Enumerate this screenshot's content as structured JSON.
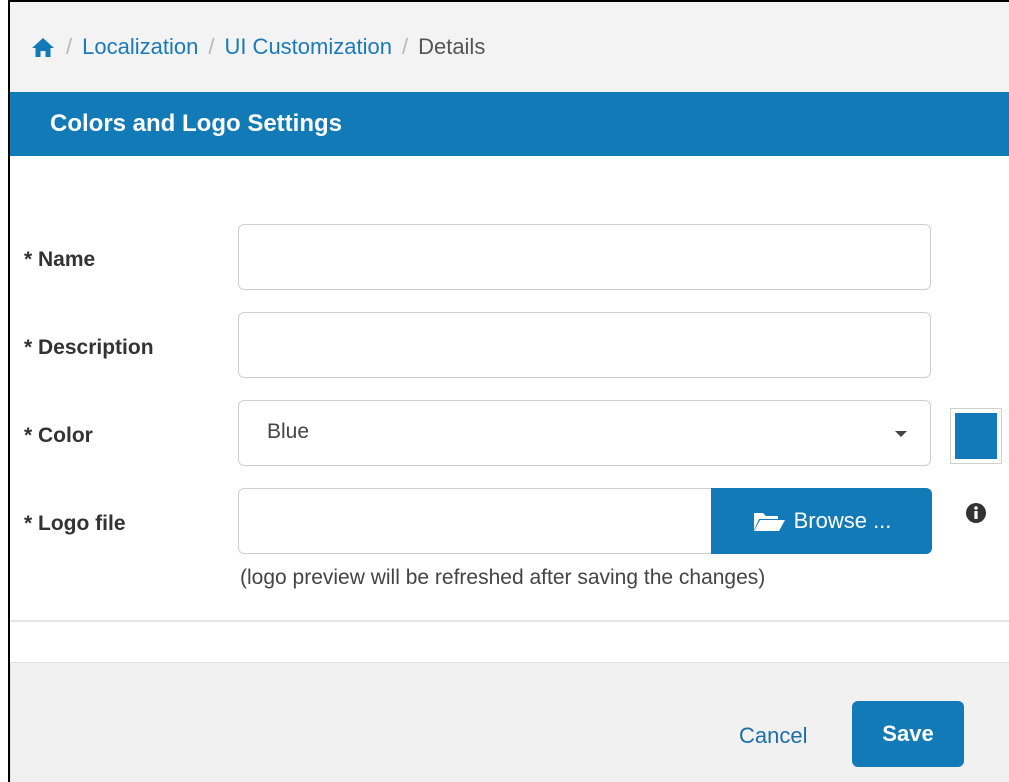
{
  "breadcrumb": {
    "home_icon": "home-icon",
    "items": [
      "Localization",
      "UI Customization",
      "Details"
    ],
    "separator": "/"
  },
  "header": {
    "title": "Colors and Logo Settings"
  },
  "form": {
    "name": {
      "label": "* Name",
      "value": ""
    },
    "description": {
      "label": "* Description",
      "value": ""
    },
    "color": {
      "label": "* Color",
      "selected": "Blue",
      "swatch_color": "#137ab8"
    },
    "logo_file": {
      "label": "* Logo file",
      "browse_label": "Browse ...",
      "hint": "(logo preview will be refreshed after saving the changes)"
    }
  },
  "footer": {
    "cancel_label": "Cancel",
    "save_label": "Save"
  },
  "colors": {
    "accent": "#137ab8",
    "link": "#1a7ab8"
  }
}
